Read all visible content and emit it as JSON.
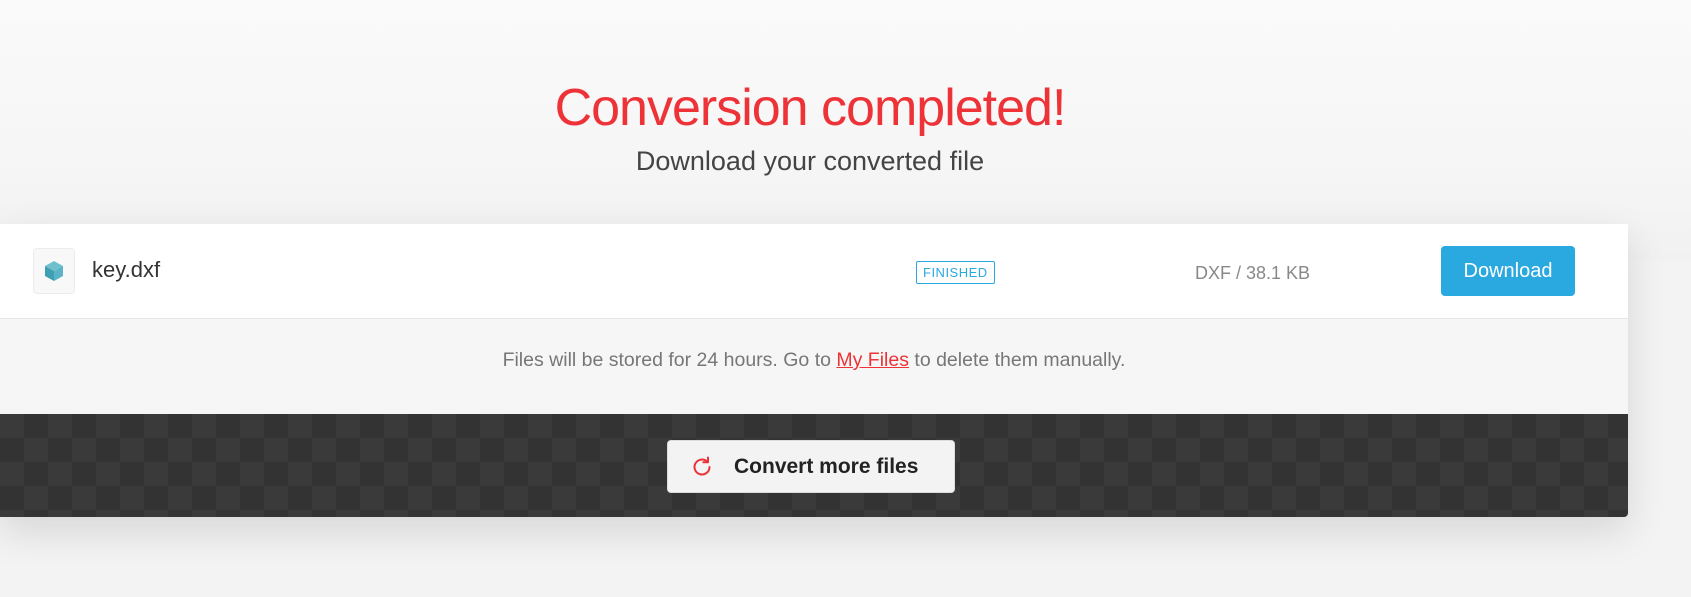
{
  "header": {
    "title": "Conversion completed!",
    "subtitle": "Download your converted file"
  },
  "file": {
    "icon": "cube-icon",
    "name": "key.dxf",
    "status": "FINISHED",
    "meta": "DXF / 38.1 KB",
    "download_label": "Download"
  },
  "notice": {
    "prefix": "Files will be stored for 24 hours. Go to ",
    "link_label": "My Files",
    "suffix": " to delete them manually."
  },
  "convert_more": {
    "icon": "refresh-icon",
    "label": "Convert more files"
  },
  "colors": {
    "accent_red": "#ee3338",
    "accent_blue": "#2aa8e0",
    "dark_bar": "#3a3a3a"
  }
}
